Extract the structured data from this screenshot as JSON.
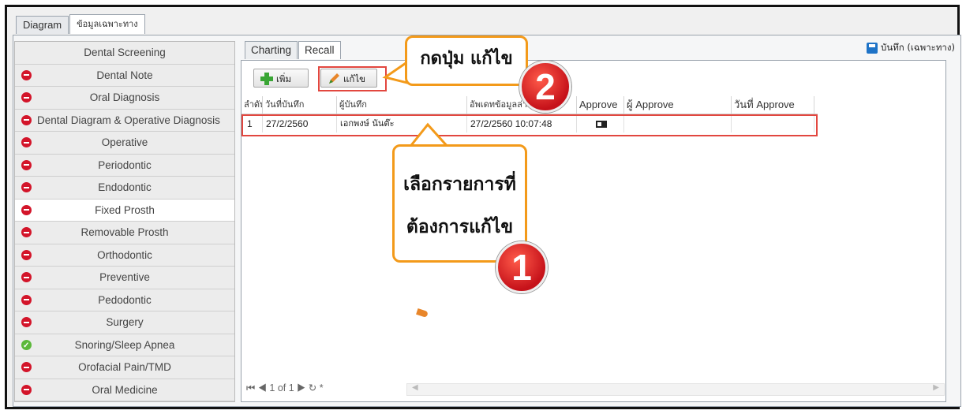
{
  "outer_tabs": [
    "Diagram",
    "ข้อมูลเฉพาะทาง"
  ],
  "sidebar": {
    "items": [
      {
        "label": "Dental Screening",
        "icon": "none"
      },
      {
        "label": "Dental Note",
        "icon": "red-minus-icon"
      },
      {
        "label": "Oral Diagnosis",
        "icon": "red-minus-icon"
      },
      {
        "label": "Dental Diagram & Operative Diagnosis",
        "icon": "red-minus-icon"
      },
      {
        "label": "Operative",
        "icon": "red-minus-icon"
      },
      {
        "label": "Periodontic",
        "icon": "red-minus-icon"
      },
      {
        "label": "Endodontic",
        "icon": "red-minus-icon"
      },
      {
        "label": "Fixed Prosth",
        "icon": "red-minus-icon",
        "selected": true
      },
      {
        "label": "Removable Prosth",
        "icon": "red-minus-icon"
      },
      {
        "label": "Orthodontic",
        "icon": "red-minus-icon"
      },
      {
        "label": "Preventive",
        "icon": "red-minus-icon"
      },
      {
        "label": "Pedodontic",
        "icon": "red-minus-icon"
      },
      {
        "label": "Surgery",
        "icon": "red-minus-icon"
      },
      {
        "label": "Snoring/Sleep Apnea",
        "icon": "green-check-icon"
      },
      {
        "label": "Orofacial Pain/TMD",
        "icon": "red-minus-icon"
      },
      {
        "label": "Oral Medicine",
        "icon": "red-minus-icon"
      }
    ]
  },
  "inner_tabs": [
    "Charting",
    "Recall"
  ],
  "save_label": "บันทึก (เฉพาะทาง)",
  "toolbar": {
    "add_label": "เพิ่ม",
    "edit_label": "แก้ไข"
  },
  "grid": {
    "columns": [
      "ลำดับ",
      "วันที่บันทึก",
      "ผู้บันทึก",
      "อัพเดทข้อมูลล่าสุด",
      "Approve",
      "ผู้ Approve",
      "วันที่ Approve"
    ],
    "rows": [
      {
        "no": "1",
        "date": "27/2/2560",
        "recorder": "เอกพงษ์ นันต๊ะ",
        "updated": "27/2/2560 10:07:48",
        "approve": "",
        "approver": "",
        "approve_date": ""
      }
    ]
  },
  "pager": {
    "text": "1 of 1"
  },
  "callouts": {
    "step2_text": "กดปุ่ม แก้ไข",
    "step1_line1": "เลือกรายการที่",
    "step1_line2": "ต้องการแก้ไข",
    "badge1": "1",
    "badge2": "2"
  },
  "colors": {
    "accent_orange": "#f39a1a",
    "badge_red": "#d3152a",
    "highlight_red": "#e2473f"
  }
}
